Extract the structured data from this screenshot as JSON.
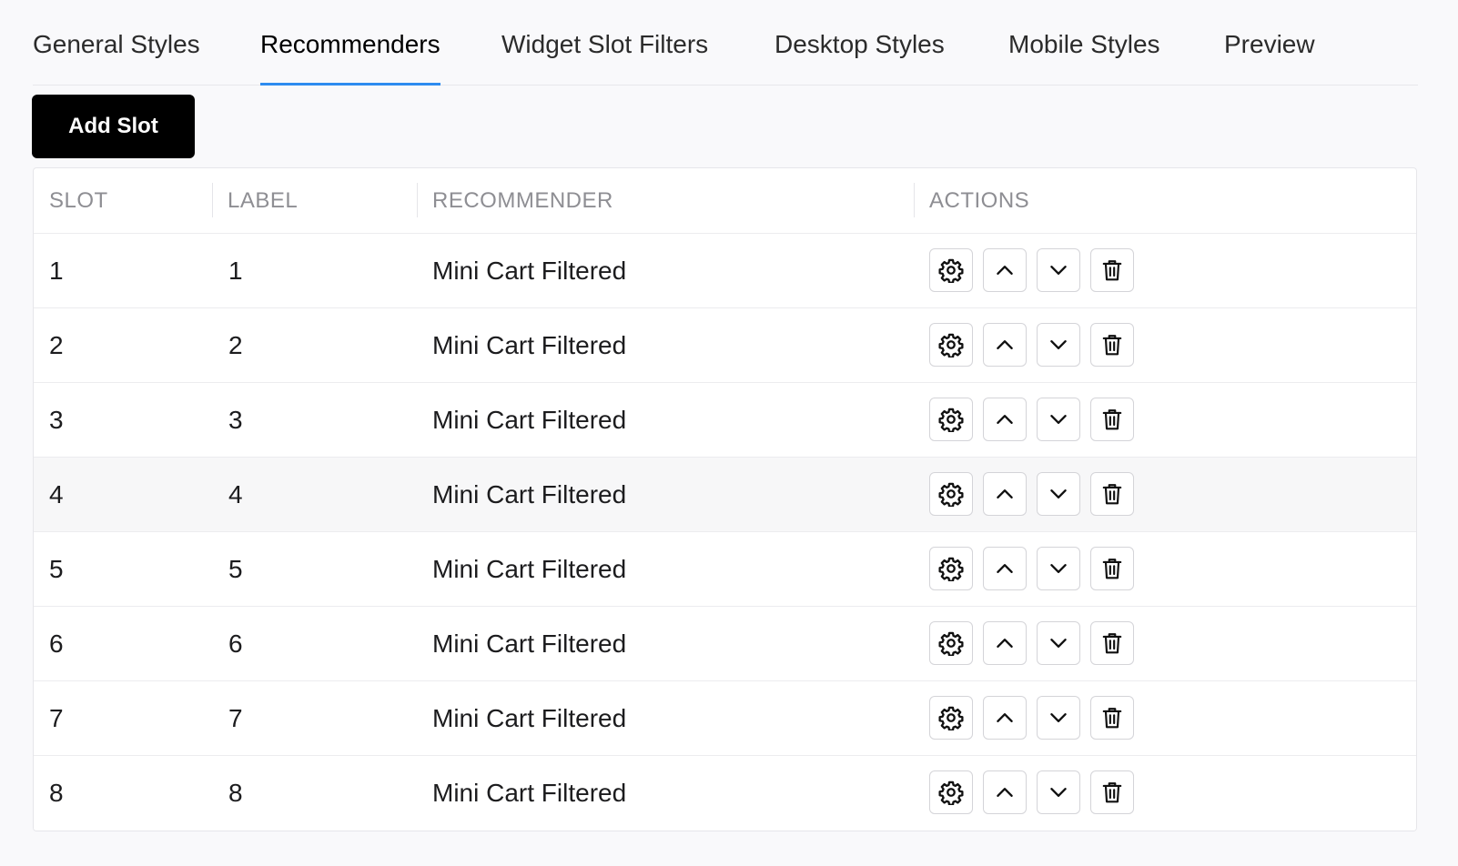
{
  "tabs": [
    {
      "label": "General Styles",
      "active": false
    },
    {
      "label": "Recommenders",
      "active": true
    },
    {
      "label": "Widget Slot Filters",
      "active": false
    },
    {
      "label": "Desktop Styles",
      "active": false
    },
    {
      "label": "Mobile Styles",
      "active": false
    },
    {
      "label": "Preview",
      "active": false
    }
  ],
  "toolbar": {
    "add_slot_label": "Add Slot"
  },
  "table": {
    "columns": [
      "SLOT",
      "LABEL",
      "RECOMMENDER",
      "ACTIONS"
    ],
    "rows": [
      {
        "slot": "1",
        "label": "1",
        "recommender": "Mini Cart Filtered"
      },
      {
        "slot": "2",
        "label": "2",
        "recommender": "Mini Cart Filtered"
      },
      {
        "slot": "3",
        "label": "3",
        "recommender": "Mini Cart Filtered"
      },
      {
        "slot": "4",
        "label": "4",
        "recommender": "Mini Cart Filtered"
      },
      {
        "slot": "5",
        "label": "5",
        "recommender": "Mini Cart Filtered"
      },
      {
        "slot": "6",
        "label": "6",
        "recommender": "Mini Cart Filtered"
      },
      {
        "slot": "7",
        "label": "7",
        "recommender": "Mini Cart Filtered"
      },
      {
        "slot": "8",
        "label": "8",
        "recommender": "Mini Cart Filtered"
      }
    ],
    "highlighted_row": 4,
    "row_actions": [
      "gear-icon",
      "chevron-up-icon",
      "chevron-down-icon",
      "trash-icon"
    ]
  },
  "colors": {
    "active_tab_underline": "#2d8cf0",
    "primary_button": "#000000",
    "header_text": "#8e8e93"
  }
}
